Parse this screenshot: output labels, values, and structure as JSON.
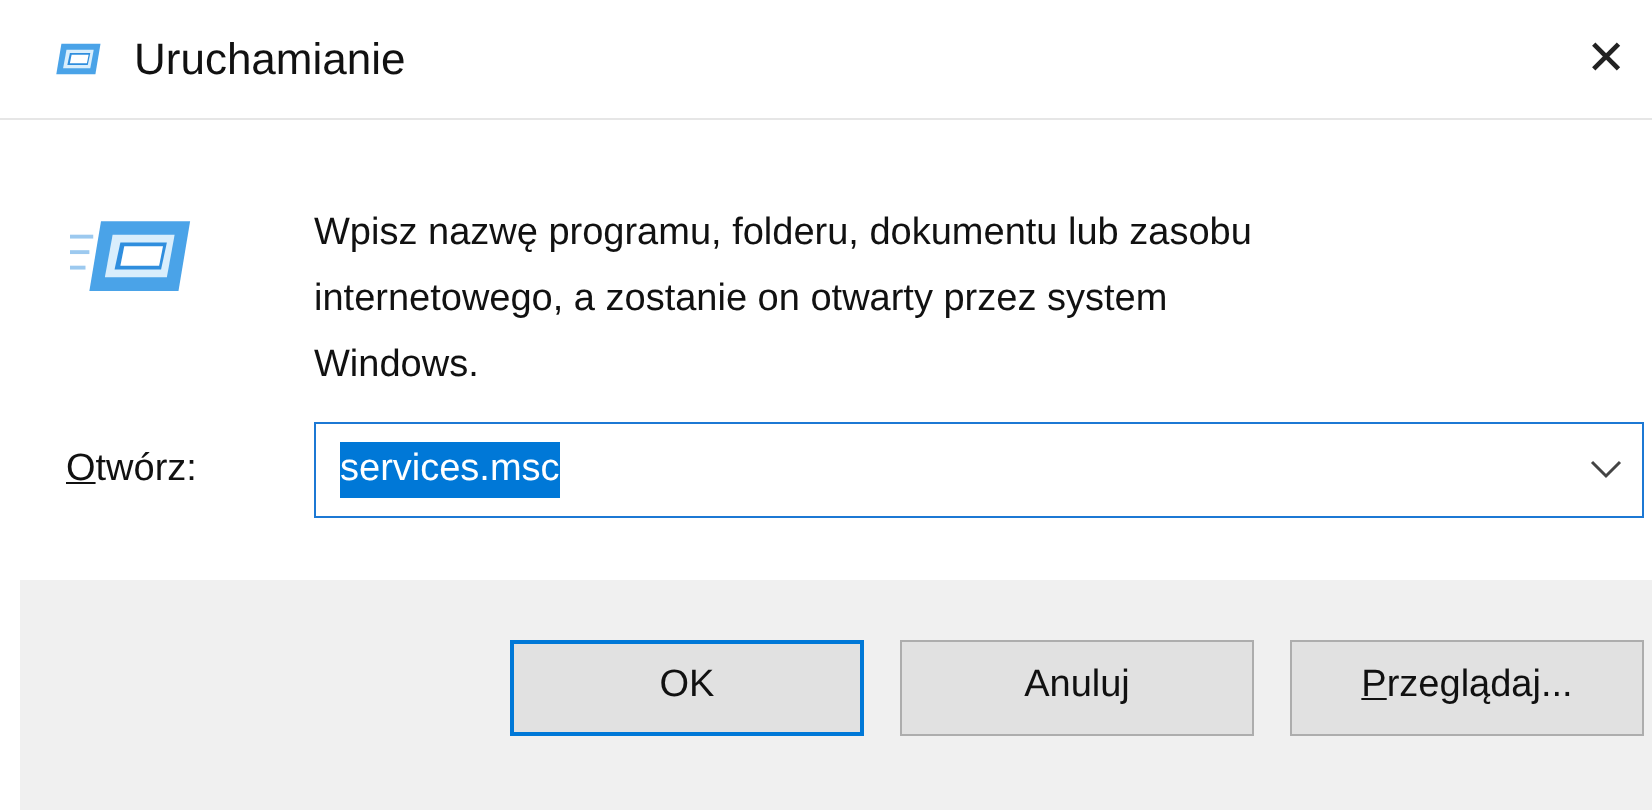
{
  "window": {
    "title": "Uruchamianie",
    "close": "✕"
  },
  "prompt": "Wpisz nazwę programu, folderu, dokumentu lub zasobu internetowego, a zostanie on otwarty przez system Windows.",
  "open_field": {
    "label": {
      "accel": "O",
      "rest": "twórz:"
    },
    "value": "services.msc",
    "text_selected": true,
    "focused": true
  },
  "buttons": [
    {
      "rest": "OK",
      "default": true
    },
    {
      "rest": "Anuluj",
      "default": false
    },
    {
      "accel": "P",
      "rest": "rzeglądaj...",
      "default": false
    }
  ]
}
